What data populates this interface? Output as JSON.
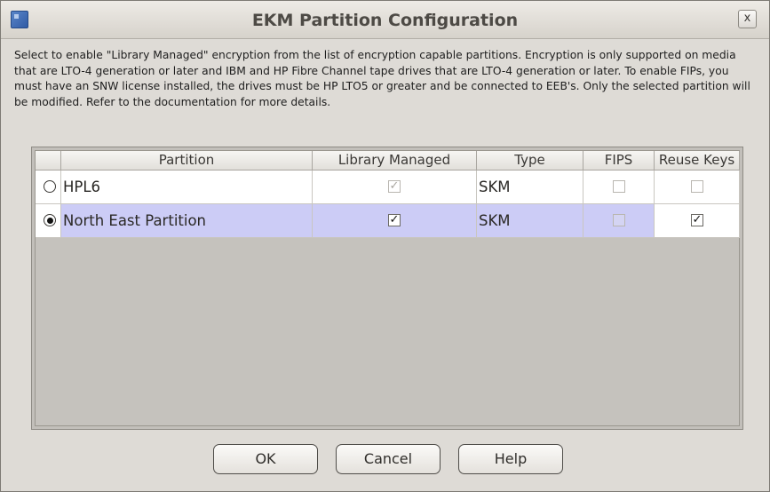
{
  "window": {
    "title": "EKM Partition Configuration",
    "close_label": "x"
  },
  "description": "Select to enable \"Library Managed\" encryption from the list of encryption capable partitions. Encryption is only supported on media that are LTO-4 generation or later and IBM and HP Fibre Channel tape drives that are LTO-4 generation or later. To enable FIPs, you must have an SNW license installed, the drives must be HP LTO5 or greater and be connected to EEB's. Only the selected partition will be modified. Refer to the documentation for more details.",
  "table": {
    "headers": [
      "Partition",
      "Library Managed",
      "Type",
      "FIPS",
      "Reuse Keys"
    ],
    "rows": [
      {
        "partition": "HPL6",
        "selected": false,
        "library_managed": true,
        "library_managed_enabled": false,
        "type": "SKM",
        "fips": false,
        "fips_enabled": true,
        "reuse_keys": false,
        "reuse_keys_enabled": false
      },
      {
        "partition": "North East Partition",
        "selected": true,
        "library_managed": true,
        "library_managed_enabled": true,
        "type": "SKM",
        "fips": false,
        "fips_enabled": false,
        "reuse_keys": true,
        "reuse_keys_enabled": true
      }
    ],
    "selection_color": "#ccccf6"
  },
  "buttons": {
    "ok": "OK",
    "cancel": "Cancel",
    "help": "Help"
  }
}
